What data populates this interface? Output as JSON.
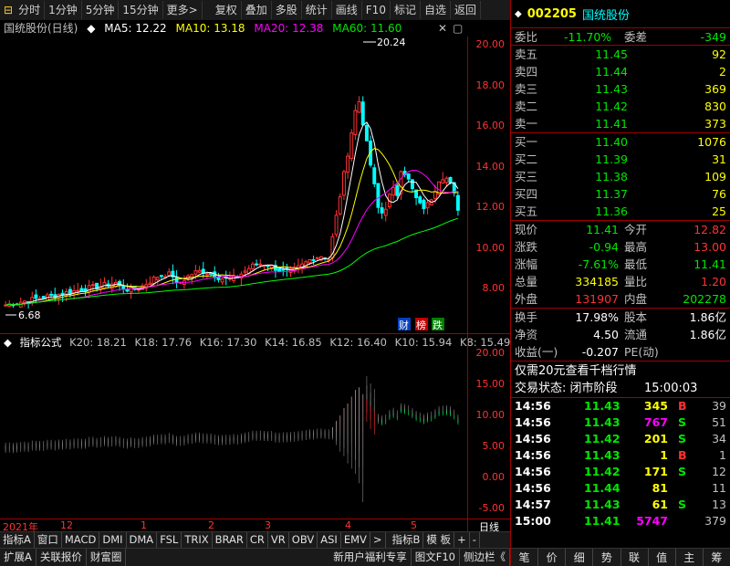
{
  "toolbar": {
    "items": [
      "分时",
      "1分钟",
      "5分钟",
      "15分钟",
      "更多>",
      "复权",
      "叠加",
      "多股",
      "统计",
      "画线",
      "F10",
      "标记",
      "自选",
      "返回"
    ]
  },
  "chart_header": {
    "stock": "国统股份(日线)",
    "ma5": "MA5: 12.22",
    "ma10": "MA10: 13.18",
    "ma20": "MA20: 12.38",
    "ma60": "MA60: 11.60"
  },
  "price_axis": [
    "20.00",
    "18.00",
    "16.00",
    "14.00",
    "12.00",
    "10.00",
    "8.00"
  ],
  "annotations": {
    "high_label": "20.24",
    "low_label": "6.68",
    "badge_cai": "财",
    "badge_bang": "榜",
    "badge_die": "跌"
  },
  "indicator_header": {
    "title": "指标公式",
    "k20": "K20: 18.21",
    "k18": "K18: 17.76",
    "k16": "K16: 17.30",
    "k14": "K14: 16.85",
    "k12": "K12: 16.40",
    "k10": "K10: 15.94",
    "k8": "K8: 15.49"
  },
  "indicator_axis": [
    "20.00",
    "15.00",
    "10.00",
    "5.00",
    "0.00",
    "-5.00"
  ],
  "date_axis": {
    "year": "2021年",
    "marks": [
      "12",
      "1",
      "2",
      "3",
      "4",
      "5"
    ],
    "period": "日线"
  },
  "indicator_tabs": [
    "指标A",
    "窗口",
    "MACD",
    "DMI",
    "DMA",
    "FSL",
    "TRIX",
    "BRAR",
    "CR",
    "VR",
    "OBV",
    "ASI",
    "EMV",
    ">",
    "指标B",
    "模 板",
    "+",
    "-"
  ],
  "bottom_bar": {
    "left": [
      "扩展A",
      "关联报价",
      "财富圈"
    ],
    "right": [
      "新用户福利专享",
      "图文F10",
      "侧边栏《"
    ]
  },
  "right_panel": {
    "code": "002205",
    "name": "国统股份",
    "weibi_label": "委比",
    "weibi_value": "-11.70%",
    "weicha_label": "委差",
    "weicha_value": "-349",
    "sell": [
      {
        "label": "卖五",
        "price": "11.45",
        "vol": "92"
      },
      {
        "label": "卖四",
        "price": "11.44",
        "vol": "2"
      },
      {
        "label": "卖三",
        "price": "11.43",
        "vol": "369"
      },
      {
        "label": "卖二",
        "price": "11.42",
        "vol": "830"
      },
      {
        "label": "卖一",
        "price": "11.41",
        "vol": "373"
      }
    ],
    "buy": [
      {
        "label": "买一",
        "price": "11.40",
        "vol": "1076"
      },
      {
        "label": "买二",
        "price": "11.39",
        "vol": "31"
      },
      {
        "label": "买三",
        "price": "11.38",
        "vol": "109"
      },
      {
        "label": "买四",
        "price": "11.37",
        "vol": "76"
      },
      {
        "label": "买五",
        "price": "11.36",
        "vol": "25"
      }
    ],
    "quote": [
      {
        "l1": "现价",
        "v1": "11.41",
        "l2": "今开",
        "v2": "12.82"
      },
      {
        "l1": "涨跌",
        "v1": "-0.94",
        "l2": "最高",
        "v2": "13.00"
      },
      {
        "l1": "涨幅",
        "v1": "-7.61%",
        "l2": "最低",
        "v2": "11.41"
      },
      {
        "l1": "总量",
        "v1": "334185",
        "l2": "量比",
        "v2": "1.20"
      },
      {
        "l1": "外盘",
        "v1": "131907",
        "l2": "内盘",
        "v2": "202278"
      }
    ],
    "stats": [
      {
        "l1": "换手",
        "v1": "17.98%",
        "l2": "股本",
        "v2": "1.86亿"
      },
      {
        "l1": "净资",
        "v1": "4.50",
        "l2": "流通",
        "v2": "1.86亿"
      },
      {
        "l1": "收益(一)",
        "v1": "-0.207",
        "l2": "PE(动)",
        "v2": ""
      }
    ],
    "promo": "仅需20元查看千档行情",
    "trade_status_label": "交易状态: 闭市阶段",
    "trade_status_time": "15:00:03",
    "ticks": [
      {
        "t": "14:56",
        "p": "11.43",
        "v": "345",
        "bs": "B",
        "n": "39"
      },
      {
        "t": "14:56",
        "p": "11.43",
        "v": "767",
        "bs": "S",
        "n": "51"
      },
      {
        "t": "14:56",
        "p": "11.42",
        "v": "201",
        "bs": "S",
        "n": "34"
      },
      {
        "t": "14:56",
        "p": "11.43",
        "v": "1",
        "bs": "B",
        "n": "1"
      },
      {
        "t": "14:56",
        "p": "11.42",
        "v": "171",
        "bs": "S",
        "n": "12"
      },
      {
        "t": "14:56",
        "p": "11.44",
        "v": "81",
        "bs": "",
        "n": "11"
      },
      {
        "t": "14:57",
        "p": "11.43",
        "v": "61",
        "bs": "S",
        "n": "13"
      },
      {
        "t": "15:00",
        "p": "11.41",
        "v": "5747",
        "bs": "",
        "n": "379"
      }
    ],
    "bottom": [
      "笔",
      "价",
      "细",
      "势",
      "联",
      "值",
      "主",
      "筹"
    ]
  }
}
